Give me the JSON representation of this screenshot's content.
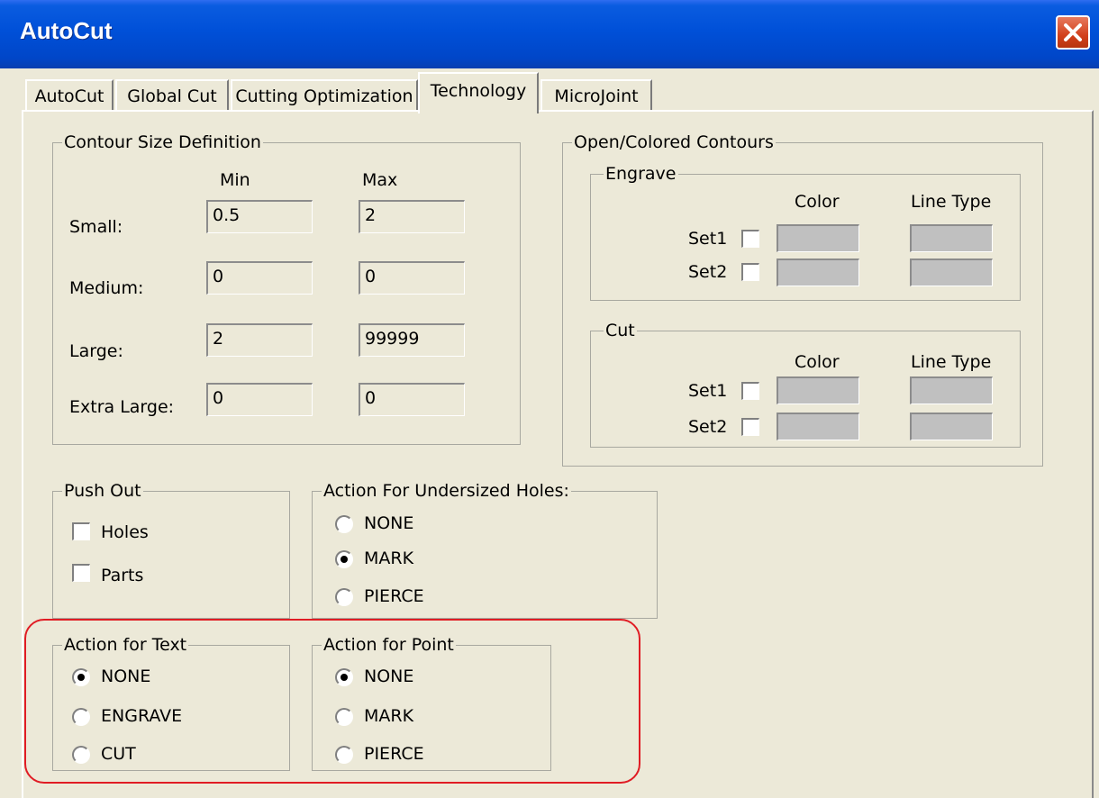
{
  "window": {
    "title": "AutoCut",
    "close_icon": "close-icon",
    "accent": "#0050d8"
  },
  "tabs": {
    "items": [
      "AutoCut",
      "Global Cut",
      "Cutting Optimization",
      "Technology",
      "MicroJoint"
    ],
    "selected": "Technology"
  },
  "contour": {
    "legend": "Contour Size Definition",
    "min_header": "Min",
    "max_header": "Max",
    "rows": [
      {
        "label": "Small:",
        "min": "0.5",
        "max": "2"
      },
      {
        "label": "Medium:",
        "min": "0",
        "max": "0"
      },
      {
        "label": "Large:",
        "min": "2",
        "max": "99999"
      },
      {
        "label": "Extra Large:",
        "min": "0",
        "max": "0"
      }
    ]
  },
  "open_colored": {
    "legend": "Open/Colored Contours",
    "engrave": {
      "legend": "Engrave",
      "color_header": "Color",
      "linetype_header": "Line Type",
      "set1": "Set1",
      "set2": "Set2",
      "set1_checked": false,
      "set2_checked": false
    },
    "cut": {
      "legend": "Cut",
      "color_header": "Color",
      "linetype_header": "Line Type",
      "set1": "Set1",
      "set2": "Set2",
      "set1_checked": false,
      "set2_checked": false
    }
  },
  "push_out": {
    "legend": "Push Out",
    "holes": "Holes",
    "parts": "Parts",
    "holes_checked": false,
    "parts_checked": false
  },
  "undersized": {
    "legend": "Action For Undersized Holes:",
    "options": [
      "NONE",
      "MARK",
      "PIERCE"
    ],
    "selected": "MARK"
  },
  "text_action": {
    "legend": "Action for Text",
    "options": [
      "NONE",
      "ENGRAVE",
      "CUT"
    ],
    "selected": "NONE"
  },
  "point_action": {
    "legend": "Action for Point",
    "options": [
      "NONE",
      "MARK",
      "PIERCE"
    ],
    "selected": "NONE"
  },
  "annotation": {
    "color": "#e01c24"
  }
}
